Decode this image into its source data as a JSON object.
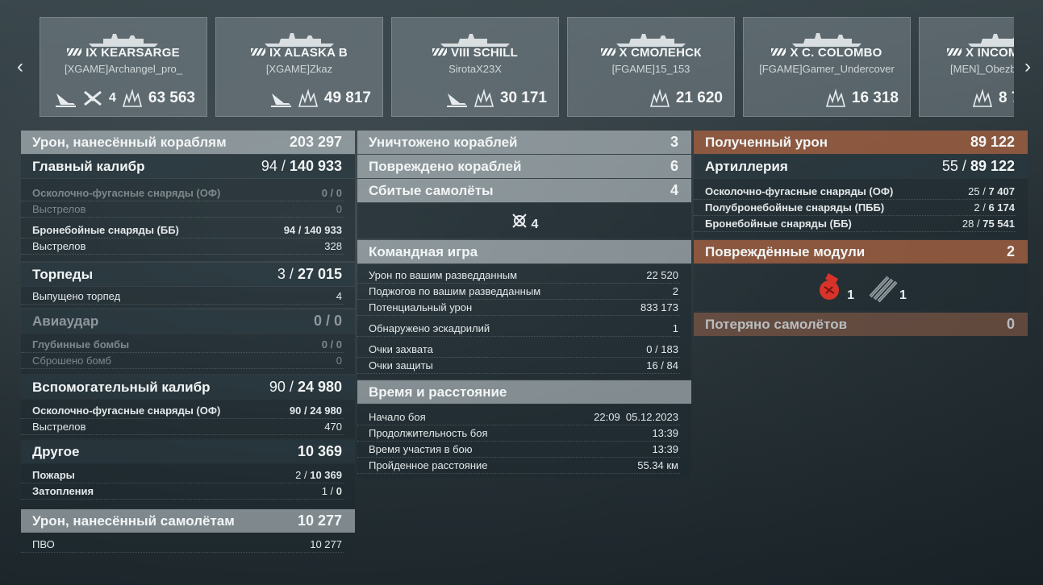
{
  "ships": [
    {
      "tier": "IX",
      "name": "KEARSARGE",
      "player": "[XGAME]Archangel_pro_",
      "icons": [
        "torpedo-hit-icon",
        "plane-kill-icon",
        "damage-icon"
      ],
      "planes": "4",
      "damage": "63 563"
    },
    {
      "tier": "IX",
      "name": "ALASKA B",
      "player": "[XGAME]Zkaz",
      "icons": [
        "torpedo-hit-icon",
        "damage-icon"
      ],
      "damage": "49 817"
    },
    {
      "tier": "VIII",
      "name": "SCHILL",
      "player": "SirotaX23X",
      "icons": [
        "torpedo-hit-icon",
        "damage-icon"
      ],
      "damage": "30 171"
    },
    {
      "tier": "X",
      "name": "СМОЛЕНСК",
      "player": "[FGAME]15_153",
      "icons": [
        "damage-icon"
      ],
      "damage": "21 620"
    },
    {
      "tier": "X",
      "name": "C. COLOMBO",
      "player": "[FGAME]Gamer_Undercover",
      "icons": [
        "damage-icon"
      ],
      "damage": "16 318"
    },
    {
      "tier": "X",
      "name": "INCOM",
      "player": "[MEN]_Obezb",
      "icons": [
        "damage-icon"
      ],
      "damage": "8 7"
    }
  ],
  "left": {
    "ship_damage": {
      "label": "Урон, нанесённый кораблям",
      "value": "203 297"
    },
    "main_battery": {
      "label": "Главный калибр",
      "hits": "94",
      "total": "140 933"
    },
    "he": {
      "label": "Осколочно-фугасные снаряды (ОФ)",
      "value": "0 / 0"
    },
    "he_shots": {
      "label": "Выстрелов",
      "value": "0"
    },
    "ap": {
      "label": "Бронебойные снаряды (ББ)",
      "hits": "94",
      "total": "140 933"
    },
    "ap_shots": {
      "label": "Выстрелов",
      "value": "328"
    },
    "torpedoes": {
      "label": "Торпеды",
      "hits": "3",
      "total": "27 015"
    },
    "torp_fired": {
      "label": "Выпущено торпед",
      "value": "4"
    },
    "air_strike": {
      "label": "Авиаудар",
      "value": "0 / 0"
    },
    "depth": {
      "label": "Глубинные бомбы",
      "value": "0 / 0"
    },
    "bombs": {
      "label": "Сброшено бомб",
      "value": "0"
    },
    "secondary": {
      "label": "Вспомогательный калибр",
      "hits": "90",
      "total": "24 980"
    },
    "sec_he": {
      "label": "Осколочно-фугасные снаряды (ОФ)",
      "hits": "90",
      "total": "24 980"
    },
    "sec_shots": {
      "label": "Выстрелов",
      "value": "470"
    },
    "other": {
      "label": "Другое",
      "value": "10 369"
    },
    "fires": {
      "label": "Пожары",
      "hits": "2",
      "total": "10 369"
    },
    "floods": {
      "label": "Затопления",
      "hits": "1",
      "total": "0"
    },
    "plane_damage": {
      "label": "Урон, нанесённый самолётам",
      "value": "10 277"
    },
    "aa": {
      "label": "ПВО",
      "value": "10 277"
    }
  },
  "middle": {
    "destroyed": {
      "label": "Уничтожено кораблей",
      "value": "3"
    },
    "damaged": {
      "label": "Повреждено кораблей",
      "value": "6"
    },
    "planes": {
      "label": "Сбитые самолёты",
      "value": "4"
    },
    "planes_icon_count": "4",
    "team": {
      "label": "Командная игра"
    },
    "spotting_damage": {
      "label": "Урон по вашим разведданным",
      "value": "22 520"
    },
    "spotting_fires": {
      "label": "Поджогов по вашим разведданным",
      "value": "2"
    },
    "potential": {
      "label": "Потенциальный урон",
      "value": "833 173"
    },
    "squadrons": {
      "label": "Обнаружено эскадрилий",
      "value": "1"
    },
    "capture": {
      "label": "Очки захвата",
      "value": "0 / 183"
    },
    "defense": {
      "label": "Очки защиты",
      "value": "16 / 84"
    },
    "time": {
      "label": "Время и расстояние"
    },
    "start": {
      "label": "Начало боя",
      "value": "22:09  05.12.2023"
    },
    "duration": {
      "label": "Продолжительность боя",
      "value": "13:39"
    },
    "participation": {
      "label": "Время участия в бою",
      "value": "13:39"
    },
    "distance": {
      "label": "Пройденное расстояние",
      "value": "55.34 км"
    }
  },
  "right": {
    "received": {
      "label": "Полученный урон",
      "value": "89 122"
    },
    "artillery": {
      "label": "Артиллерия",
      "hits": "55",
      "total": "89 122"
    },
    "he": {
      "label": "Осколочно-фугасные снаряды (ОФ)",
      "hits": "25",
      "total": "7 407"
    },
    "sap": {
      "label": "Полубронебойные снаряды (ПББ)",
      "hits": "2",
      "total": "6 174"
    },
    "ap": {
      "label": "Бронебойные снаряды (ББ)",
      "hits": "28",
      "total": "75 541"
    },
    "modules": {
      "label": "Повреждённые модули",
      "value": "2"
    },
    "module_items": [
      {
        "icon": "engine-module-icon",
        "count": "1"
      },
      {
        "icon": "torpedo-tube-module-icon",
        "count": "1"
      }
    ],
    "lost_planes": {
      "label": "Потеряно самолётов",
      "value": "0"
    }
  },
  "colors": {
    "rust": "#985c40",
    "module_red": "#d8332a"
  }
}
